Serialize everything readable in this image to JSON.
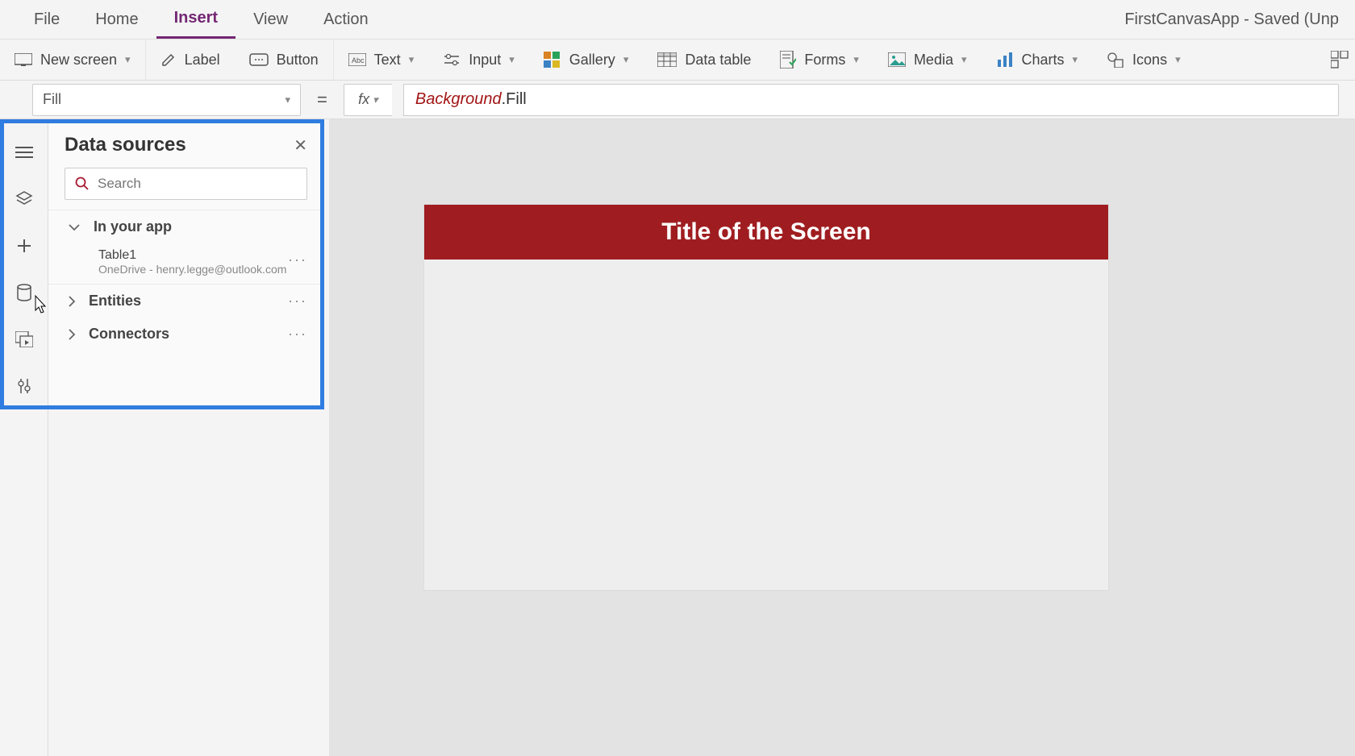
{
  "menu": {
    "items": [
      "File",
      "Home",
      "Insert",
      "View",
      "Action"
    ],
    "active_index": 2
  },
  "app_title": "FirstCanvasApp - Saved (Unp",
  "ribbon": {
    "new_screen": "New screen",
    "label": "Label",
    "button": "Button",
    "text": "Text",
    "input": "Input",
    "gallery": "Gallery",
    "data_table": "Data table",
    "forms": "Forms",
    "media": "Media",
    "charts": "Charts",
    "icons": "Icons"
  },
  "formula": {
    "property": "Fill",
    "fx_label": "fx",
    "token1": "Background",
    "token_dot": ".",
    "token2": "Fill"
  },
  "data_sources": {
    "title": "Data sources",
    "search_placeholder": "Search",
    "in_your_app": "In your app",
    "table_name": "Table1",
    "table_sub": "OneDrive - henry.legge@outlook.com",
    "entities": "Entities",
    "connectors": "Connectors"
  },
  "canvas": {
    "screen_title": "Title of the Screen"
  }
}
